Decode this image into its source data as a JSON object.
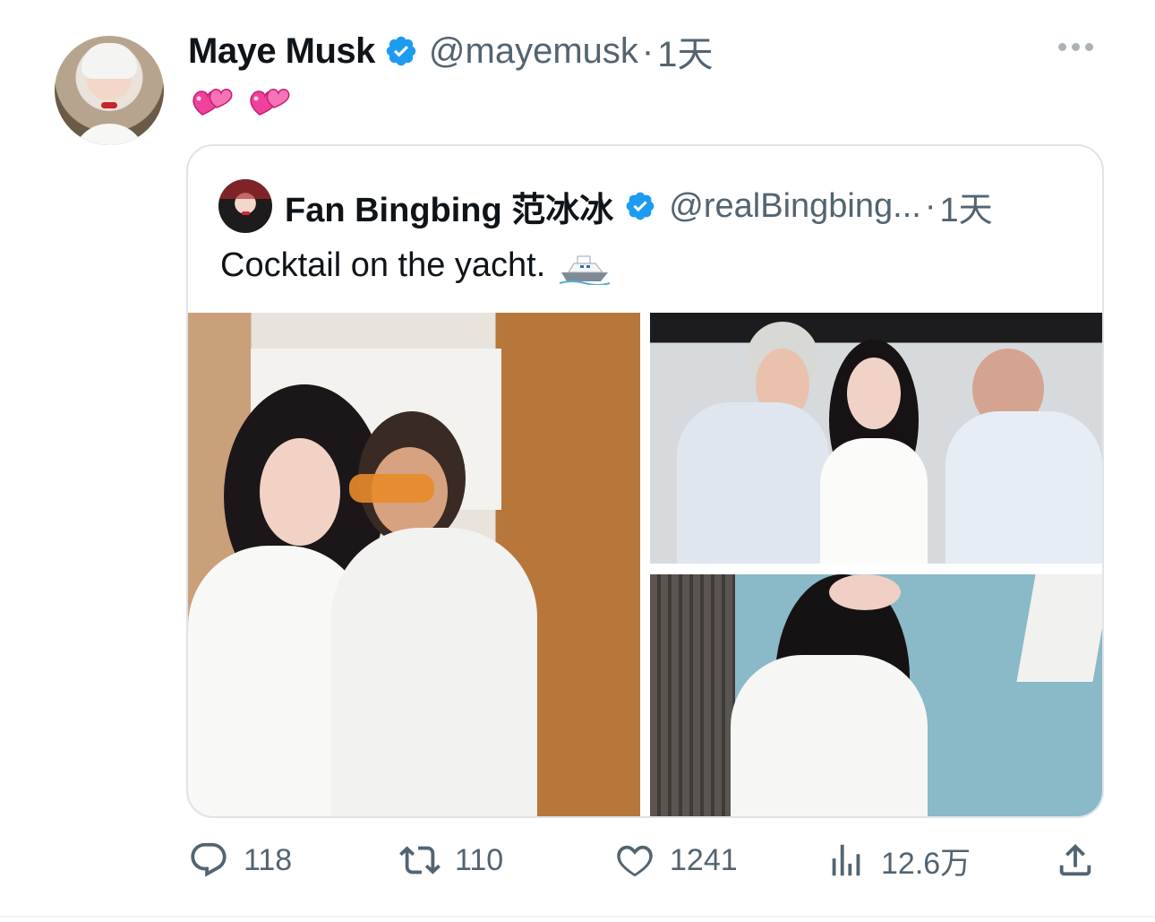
{
  "tweet": {
    "author": {
      "name": "Maye Musk",
      "handle": "@mayemusk",
      "time": "1天"
    },
    "dot": "·",
    "text_emoji": "heart-pair-emoji x2",
    "quote": {
      "author": {
        "name": "Fan Bingbing 范冰冰",
        "handle": "@realBingbing...",
        "time": "1天"
      },
      "text": "Cocktail on the yacht.",
      "text_emoji": "ship-emoji"
    },
    "actions": {
      "replies": "118",
      "reposts": "110",
      "likes": "1241",
      "views": "12.6万"
    }
  },
  "colors": {
    "verified": "#1d9bf0",
    "secondary_text": "#536471",
    "border": "#dfe4e8",
    "heart_emoji": "#f0429b"
  }
}
